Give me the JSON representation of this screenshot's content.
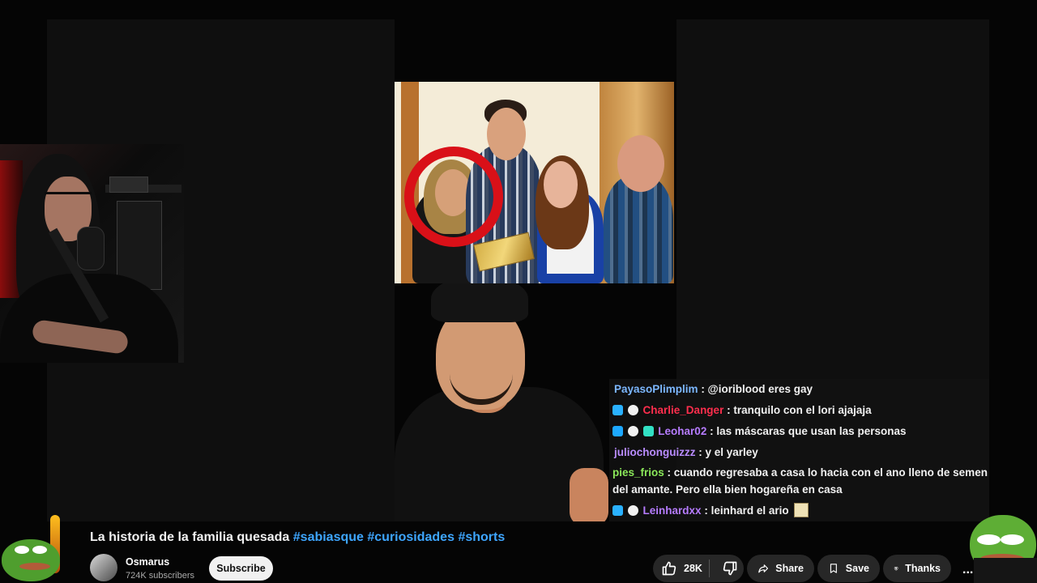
{
  "video": {
    "title_prefix": "La historia de la familia quesada",
    "hashtags": [
      "#sabiasque",
      "#curiosidades",
      "#shorts"
    ],
    "channel": "Osmarus",
    "subscribers": "724K subscribers",
    "subscribe_label": "Subscribe"
  },
  "actions": {
    "likes": "28K",
    "share": "Share",
    "save": "Save",
    "thanks": "Thanks",
    "more": "..."
  },
  "chat": {
    "messages": [
      {
        "user": "PayasoPlimplim",
        "text": ": @ioriblood eres gay",
        "color": "#7cb7ff",
        "badges": []
      },
      {
        "user": "Charlie_Danger",
        "text": ": tranquilo con el lori ajajaja",
        "color": "#ff2e4d",
        "badges": [
          "blue-cube-badge",
          "round-badge"
        ]
      },
      {
        "user": "Leohar02",
        "text": ": las máscaras que usan las personas",
        "color": "#b67cff",
        "badges": [
          "blue-play-badge",
          "round-badge",
          "teal-badge"
        ]
      },
      {
        "user": "juliochonguizzz",
        "text": ": y el yarley",
        "color": "#b98cff",
        "badges": []
      },
      {
        "user": "pies_frios",
        "text": ": cuando regresaba a casa lo hacia con el ano lleno de semen del amante. Pero ella bien hogareña en casa",
        "color": "#8be85a",
        "badges": []
      },
      {
        "user": "Leinhardxx",
        "text": ": leinhard el ario",
        "color": "#b67cff",
        "badges": [
          "blue-cube-badge",
          "round-badge"
        ]
      }
    ]
  },
  "colors": {
    "page_bg": "#050505",
    "player_bg": "#0f0f0f",
    "hashtag": "#3ea6ff",
    "button_bg": "#272727",
    "subscribe_bg": "#f1f1f1",
    "highlight_circle": "#d91018"
  },
  "icons": {
    "like": "thumbs-up-icon",
    "dislike": "thumbs-down-icon",
    "share": "share-arrow-icon",
    "save": "bookmark-icon",
    "thanks": "heart-dollar-icon"
  }
}
